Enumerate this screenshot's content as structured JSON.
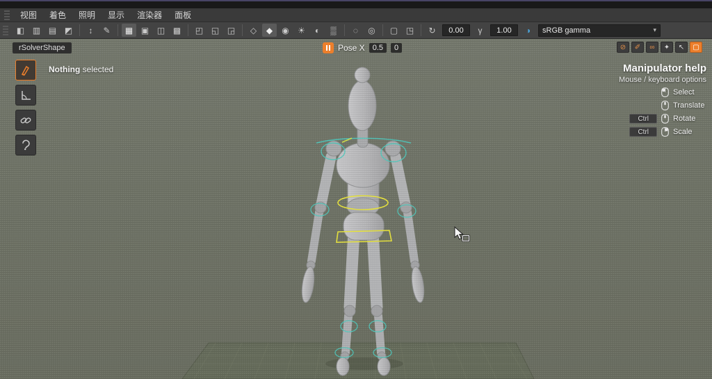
{
  "accent": {
    "orange": "#ec7f2c",
    "teal": "#4fc9bd",
    "yellow": "#e6e23e",
    "blue": "#4aa3d8"
  },
  "menu": {
    "items": [
      "视图",
      "着色",
      "照明",
      "显示",
      "渲染器",
      "面板"
    ]
  },
  "toolbar": {
    "items": [
      {
        "name": "plain-shade-icon",
        "g": "◧"
      },
      {
        "name": "wireframe-on-shaded-icon",
        "g": "▥"
      },
      {
        "name": "textured-mode-icon",
        "g": "▤"
      },
      {
        "name": "default-material-icon",
        "g": "◩"
      },
      {
        "name": "two-sided-lighting-icon",
        "g": "↕"
      },
      {
        "name": "edit-mode-icon",
        "g": "✎"
      },
      {
        "name": "grid-toggle-icon",
        "g": "▦"
      },
      {
        "name": "film-gate-icon",
        "g": "▣"
      },
      {
        "name": "resolution-gate-icon",
        "g": "◫"
      },
      {
        "name": "gate-mask-icon",
        "g": "▩"
      },
      {
        "name": "field-chart-icon",
        "g": "◰"
      },
      {
        "name": "safe-action-icon",
        "g": "◱"
      },
      {
        "name": "safe-title-icon",
        "g": "◲"
      },
      {
        "name": "wireframe-display-icon",
        "g": "◇"
      },
      {
        "name": "smooth-shade-icon",
        "g": "◆"
      },
      {
        "name": "hardware-texturing-icon",
        "g": "◉"
      },
      {
        "name": "use-all-lights-icon",
        "g": "☀"
      },
      {
        "name": "shadows-icon",
        "g": "◐"
      },
      {
        "name": "screen-space-ao-icon",
        "g": "▒"
      },
      {
        "name": "isolate-select-icon",
        "g": "◌"
      },
      {
        "name": "image-plane-icon",
        "g": "◎"
      },
      {
        "name": "xray-display-icon",
        "g": "▢"
      },
      {
        "name": "camera-settings-icon",
        "g": "◳"
      }
    ],
    "exposure_icon": "↻",
    "exposure": "0.00",
    "gamma_icon": "γ",
    "gamma": "1.00",
    "colorspace_icon": "◑",
    "colorspace": "sRGB gamma",
    "chevron": "▾"
  },
  "quick_buttons": [
    {
      "name": "snap-magnet-button",
      "g": "⊘"
    },
    {
      "name": "pick-pivot-button",
      "g": "✐"
    },
    {
      "name": "link-button",
      "g": "∞"
    },
    {
      "name": "character-button",
      "g": "✦"
    },
    {
      "name": "expand-view-button",
      "g": "↖"
    },
    {
      "name": "panel-toggle-button",
      "g": "▢"
    }
  ],
  "viewport": {
    "shape_label": "rSolverShape",
    "status_bold": "Nothing",
    "status_rest": " selected",
    "pose": {
      "label": "Pose X",
      "v1": "0.5",
      "v2": "0"
    }
  },
  "help": {
    "title": "Manipulator help",
    "subtitle": "Mouse / keyboard options",
    "ctrl": "Ctrl",
    "rows": [
      {
        "label": "Select"
      },
      {
        "label": "Translate"
      },
      {
        "label": "Rotate"
      },
      {
        "label": "Scale"
      }
    ]
  }
}
